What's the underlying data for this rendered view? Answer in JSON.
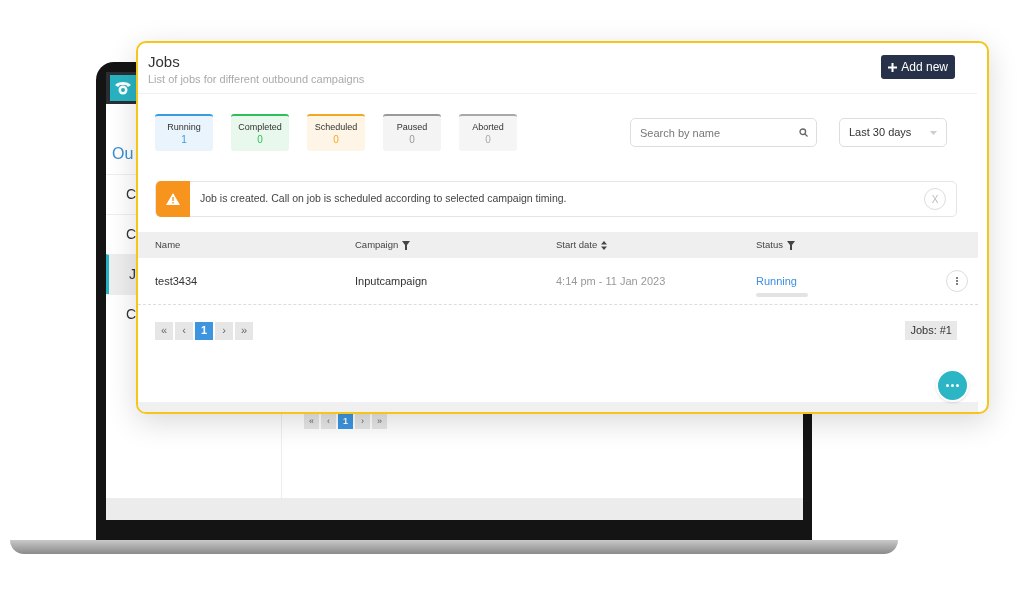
{
  "laptop": {
    "sidebar": {
      "heading": "Ou",
      "items": [
        {
          "label": "C",
          "selected": false
        },
        {
          "label": "C",
          "selected": false
        },
        {
          "label": "J",
          "selected": true
        },
        {
          "label": "C",
          "selected": false
        }
      ]
    },
    "pagination": [
      {
        "label": "«",
        "selected": false
      },
      {
        "label": "‹",
        "selected": false
      },
      {
        "label": "1",
        "selected": true
      },
      {
        "label": "›",
        "selected": false
      },
      {
        "label": "»",
        "selected": false
      }
    ]
  },
  "panel": {
    "title": "Jobs",
    "subtitle": "List of jobs for different outbound campaigns",
    "add_button": "Add new",
    "stats": [
      {
        "label": "Running",
        "count": "1",
        "color": "#3b9be0"
      },
      {
        "label": "Completed",
        "count": "0",
        "color": "#2fbf5a"
      },
      {
        "label": "Scheduled",
        "count": "0",
        "color": "#f5a623"
      },
      {
        "label": "Paused",
        "count": "0",
        "color": "#9a9a9a"
      },
      {
        "label": "Aborted",
        "count": "0",
        "color": "#a8a8a8"
      }
    ],
    "search": {
      "placeholder": "Search by name"
    },
    "period": {
      "value": "Last 30 days"
    },
    "alert": {
      "text": "Job is created. Call on job is scheduled according to selected campaign timing.",
      "close_label": "X"
    },
    "table": {
      "columns": [
        {
          "label": "Name",
          "kind": "plain"
        },
        {
          "label": "Campaign",
          "kind": "filter"
        },
        {
          "label": "Start date",
          "kind": "sort"
        },
        {
          "label": "Status",
          "kind": "filter"
        }
      ],
      "rows": [
        {
          "name": "test3434",
          "campaign": "Inputcampaign",
          "start_date": "4:14 pm - 11 Jan 2023",
          "status": "Running",
          "level": 0
        }
      ]
    },
    "pagination": [
      {
        "label": "«",
        "selected": false
      },
      {
        "label": "‹",
        "selected": false
      },
      {
        "label": "1",
        "selected": true
      },
      {
        "label": "›",
        "selected": false
      },
      {
        "label": "»",
        "selected": false
      }
    ],
    "total": "Jobs: #1"
  }
}
